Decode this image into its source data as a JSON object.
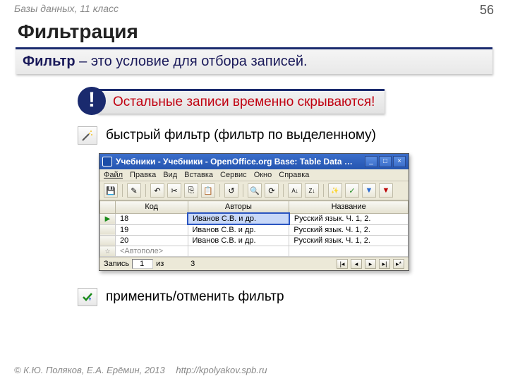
{
  "header": {
    "course": "Базы данных, 11 класс",
    "page": "56"
  },
  "title": "Фильтрация",
  "definition": {
    "term": "Фильтр",
    "rest": " – это условие для отбора записей."
  },
  "note": {
    "bang": "!",
    "text": "Остальные записи временно скрываются!"
  },
  "item1": {
    "text": "быстрый фильтр (фильтр по выделенному)"
  },
  "item2": {
    "text": "применить/отменить фильтр"
  },
  "win": {
    "title": "Учебники - Учебники - OpenOffice.org Base: Table Data …",
    "menu": [
      "Файл",
      "Правка",
      "Вид",
      "Вставка",
      "Сервис",
      "Окно",
      "Справка"
    ],
    "cols": [
      "Код",
      "Авторы",
      "Название"
    ],
    "rows": [
      {
        "code": "18",
        "auth": "Иванов С.В. и др.",
        "title": "Русский язык. Ч. 1, 2."
      },
      {
        "code": "19",
        "auth": "Иванов С.В. и др.",
        "title": "Русский язык. Ч. 1, 2."
      },
      {
        "code": "20",
        "auth": "Иванов С.В. и др.",
        "title": "Русский язык. Ч. 1, 2."
      }
    ],
    "autofield": "<Автополе>",
    "status": {
      "label": "Запись",
      "cur": "1",
      "of": "из",
      "total": "3"
    }
  },
  "footer": {
    "copy": "© К.Ю. Поляков, Е.А. Ерёмин, 2013",
    "url": "http://kpolyakov.spb.ru"
  }
}
